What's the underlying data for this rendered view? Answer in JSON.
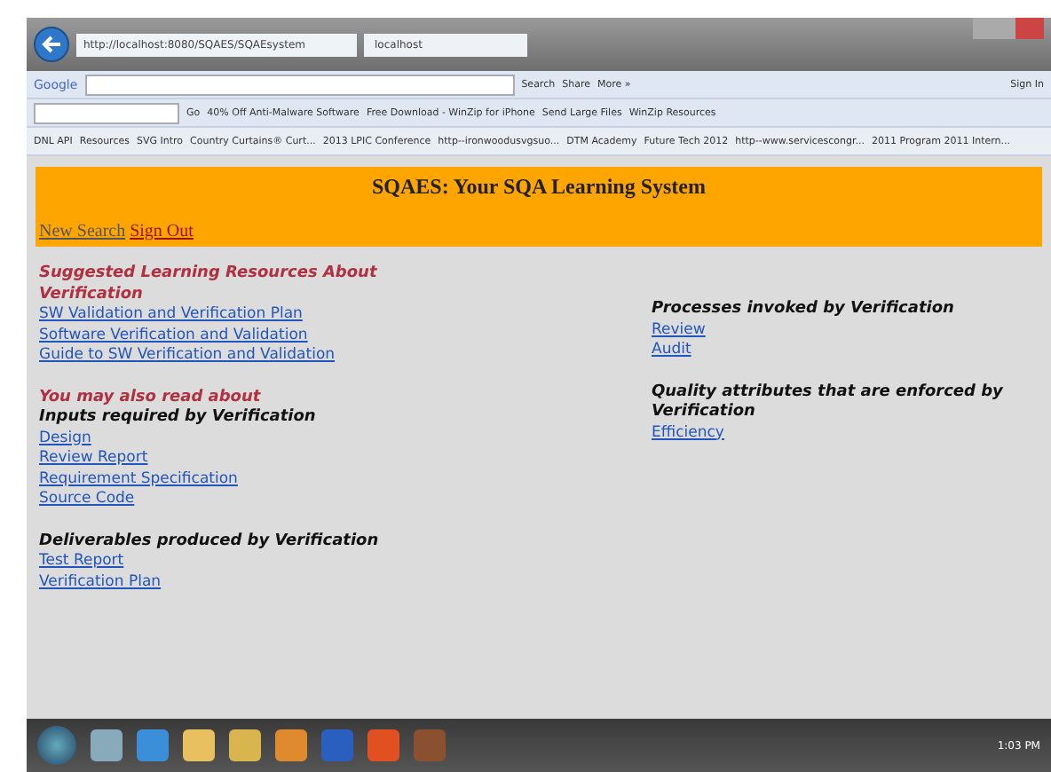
{
  "browser": {
    "address": "http://localhost:8080/SQAES/SQAEsystem",
    "tabs": [
      {
        "label": "localhost",
        "selected": true
      }
    ]
  },
  "google_bar": {
    "logo": "Google",
    "buttons": [
      "Search",
      "Share",
      "More »"
    ],
    "sign_in": "Sign In"
  },
  "toolbar": {
    "go": "Go",
    "links": [
      "40% Off Anti-Malware Software",
      "Free Download - WinZip for iPhone",
      "Send Large Files",
      "WinZip Resources"
    ]
  },
  "favorites": [
    "DNL API",
    "Resources",
    "SVG Intro",
    "Country Curtains® Curt...",
    "2013 LPIC Conference",
    "http--ironwoodusvgsuo...",
    "DTM Academy",
    "Future Tech 2012",
    "http--www.servicescongr...",
    "2011 Program 2011 Intern..."
  ],
  "page": {
    "title": "SQAES: Your SQA Learning System",
    "nav": [
      "New Search",
      "Sign Out"
    ],
    "left": [
      {
        "kind": "heading",
        "text": "Suggested Learning Resources About Verification"
      },
      {
        "kind": "link",
        "text": "SW Validation and Verification Plan"
      },
      {
        "kind": "link",
        "text": "Software Verification and Validation"
      },
      {
        "kind": "link",
        "text": "Guide to SW Verification and Validation"
      },
      {
        "kind": "gap"
      },
      {
        "kind": "heading",
        "text": "You may also read about"
      },
      {
        "kind": "subheading",
        "text": "Inputs required by Verification"
      },
      {
        "kind": "link",
        "text": "Design"
      },
      {
        "kind": "link",
        "text": "Review Report"
      },
      {
        "kind": "link",
        "text": "Requirement Specification"
      },
      {
        "kind": "link",
        "text": "Source Code"
      },
      {
        "kind": "gap"
      },
      {
        "kind": "subheading",
        "text": "Deliverables produced by Verification"
      },
      {
        "kind": "link",
        "text": "Test  Report"
      },
      {
        "kind": "link",
        "text": "Verification  Plan"
      }
    ],
    "right": [
      {
        "kind": "subheading",
        "text": "Processes invoked by Verification"
      },
      {
        "kind": "link",
        "text": "Review"
      },
      {
        "kind": "link",
        "text": "Audit"
      },
      {
        "kind": "gap"
      },
      {
        "kind": "subheading",
        "text": "Quality attributes that are enforced by Verification"
      },
      {
        "kind": "link",
        "text": "Efficiency"
      }
    ]
  },
  "taskbar": {
    "clock": "1:03 PM"
  }
}
